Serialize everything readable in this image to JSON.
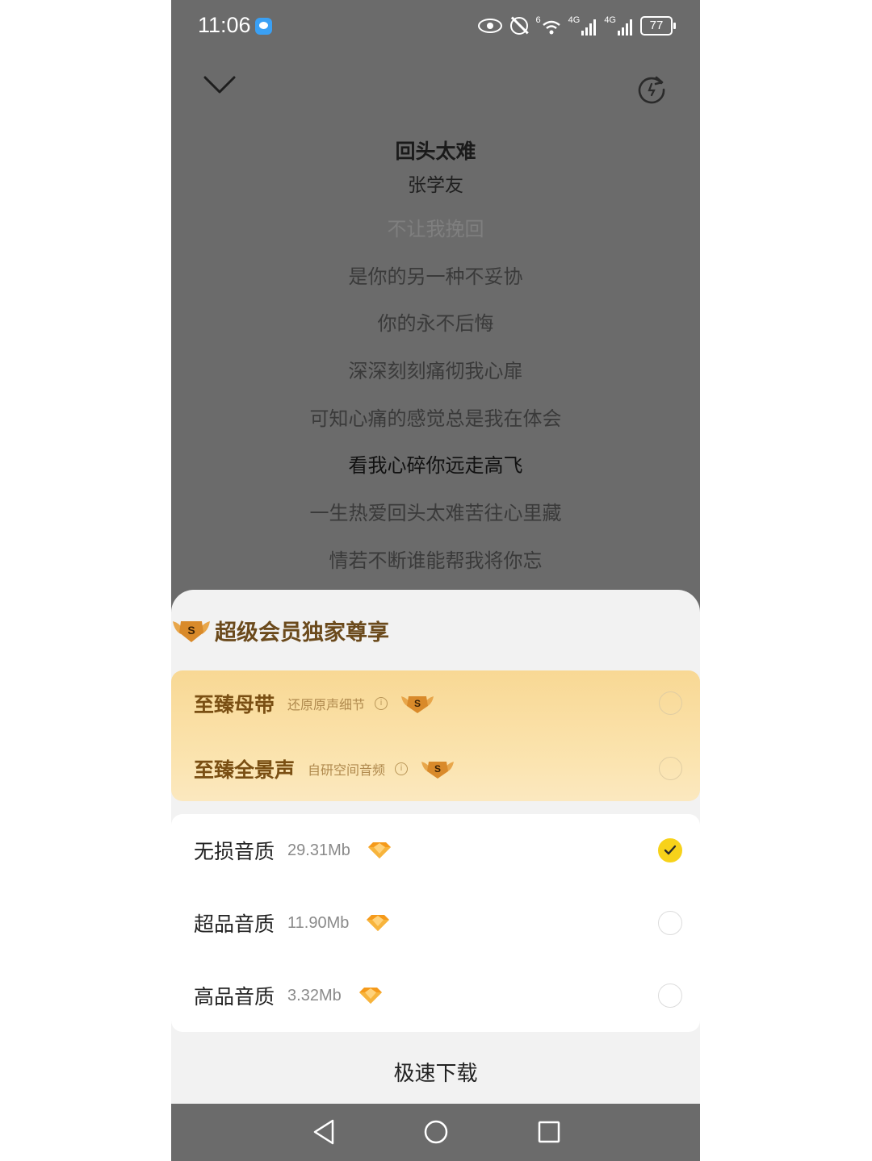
{
  "status_bar": {
    "time": "11:06",
    "network_1": "4G",
    "network_2": "4G",
    "wifi_label": "6",
    "battery": "77"
  },
  "song": {
    "title": "回头太难",
    "artist": "张学友"
  },
  "lyrics": [
    "不让我挽回",
    "是你的另一种不妥协",
    "你的永不后悔",
    "深深刻刻痛彻我心扉",
    "可知心痛的感觉总是我在体会",
    "看我心碎你远走高飞",
    "一生热爱回头太难苦往心里藏",
    "情若不断谁能帮我将你忘"
  ],
  "active_lyric_index": 5,
  "sheet": {
    "title": "超级会员独家尊享",
    "badge_letter": "S",
    "premium_options": [
      {
        "name": "至臻母带",
        "desc": "还原原声细节",
        "info": "i"
      },
      {
        "name": "至臻全景声",
        "desc": "自研空间音频",
        "info": "i"
      }
    ],
    "quality_options": [
      {
        "name": "无损音质",
        "size": "29.31Mb",
        "selected": true
      },
      {
        "name": "超品音质",
        "size": "11.90Mb",
        "selected": false
      },
      {
        "name": "高品音质",
        "size": "3.32Mb",
        "selected": false
      }
    ],
    "download_label": "极速下载"
  },
  "colors": {
    "overlay": "#6b6b6b",
    "gold_text": "#7a4f13",
    "selected": "#f7d21a",
    "diamond": "#f59a1a"
  }
}
